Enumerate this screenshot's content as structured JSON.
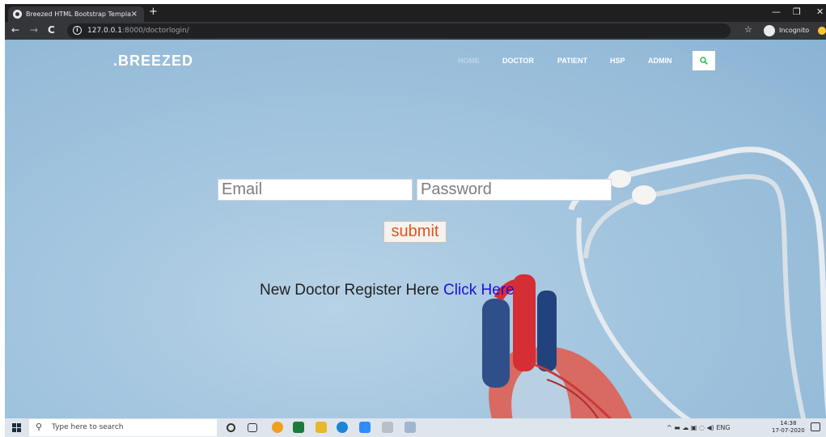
{
  "browser": {
    "tab_title": "Breezed HTML Bootstrap Templa",
    "tab_close": "×",
    "new_tab": "+",
    "window_minimize": "—",
    "window_restore": "❐",
    "window_close": "✕",
    "back": "←",
    "forward": "→",
    "reload": "C",
    "url_host": "127.0.0.1",
    "url_rest": ":8000/doctorlogin/",
    "bookmark": "☆",
    "incognito_label": "Incognito"
  },
  "site": {
    "brand": ".BREEZED",
    "nav": {
      "home": "HOME",
      "doctor": "DOCTOR",
      "patient": "PATIENT",
      "hsp": "HSP",
      "admin": "ADMIN"
    },
    "accent_color": "#2ec15a"
  },
  "form": {
    "email_placeholder": "Email",
    "password_placeholder": "Password",
    "submit_label": "submit",
    "register_text": "New Doctor Register Here ",
    "register_link": "Click Here"
  },
  "taskbar": {
    "search_placeholder": "Type here to search",
    "language": "ENG",
    "time": "14:38",
    "date": "17-07-2020"
  }
}
